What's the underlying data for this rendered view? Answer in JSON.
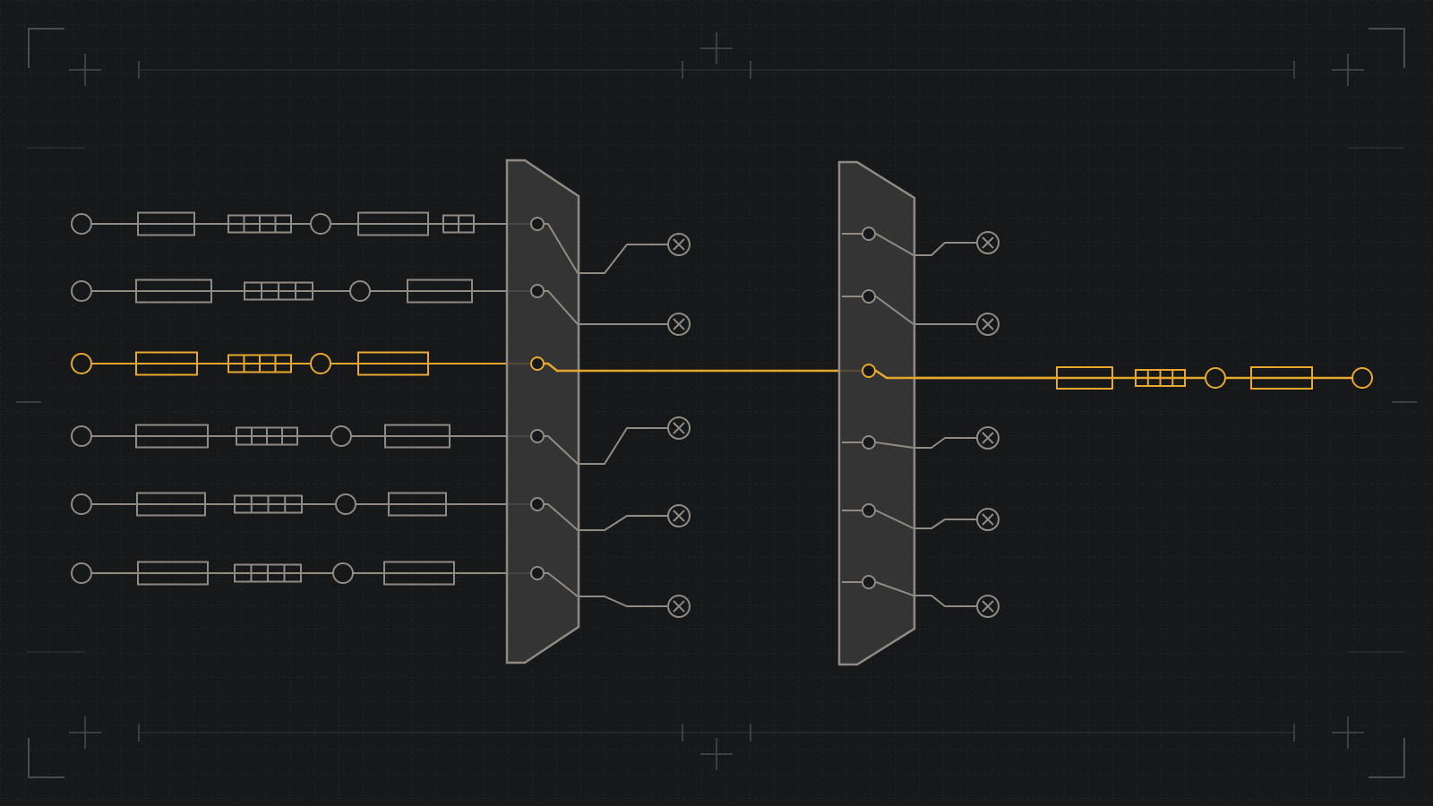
{
  "colors": {
    "background": "#17181a",
    "grid": "#2a2c2f",
    "frame": "#4a4b4d",
    "wire": "#8f8a84",
    "active": "#e6a82e",
    "mux_fill": "#3a3a3a",
    "mux_stroke": "#8f8a84"
  },
  "diagram": {
    "type": "two-stage multiplexer signal routing",
    "input_channels": 6,
    "selected_input_index": 2,
    "stage_one_outputs": 6,
    "stage_two_outputs": 6,
    "selected_output_index": 2,
    "channels": [
      {
        "components": [
          "node",
          "block",
          "register-4",
          "node",
          "block",
          "register-2"
        ]
      },
      {
        "components": [
          "node",
          "block",
          "register-4",
          "node",
          "block"
        ]
      },
      {
        "components": [
          "node",
          "block",
          "register-4",
          "node",
          "block"
        ],
        "active": true
      },
      {
        "components": [
          "node",
          "block",
          "register-4",
          "node",
          "block"
        ]
      },
      {
        "components": [
          "node",
          "block",
          "register-4",
          "node",
          "block"
        ]
      },
      {
        "components": [
          "node",
          "block",
          "register-4",
          "node",
          "block"
        ]
      }
    ],
    "output_chain": [
      "block",
      "register-4",
      "node",
      "block",
      "node"
    ],
    "terminators": "x-circle"
  }
}
